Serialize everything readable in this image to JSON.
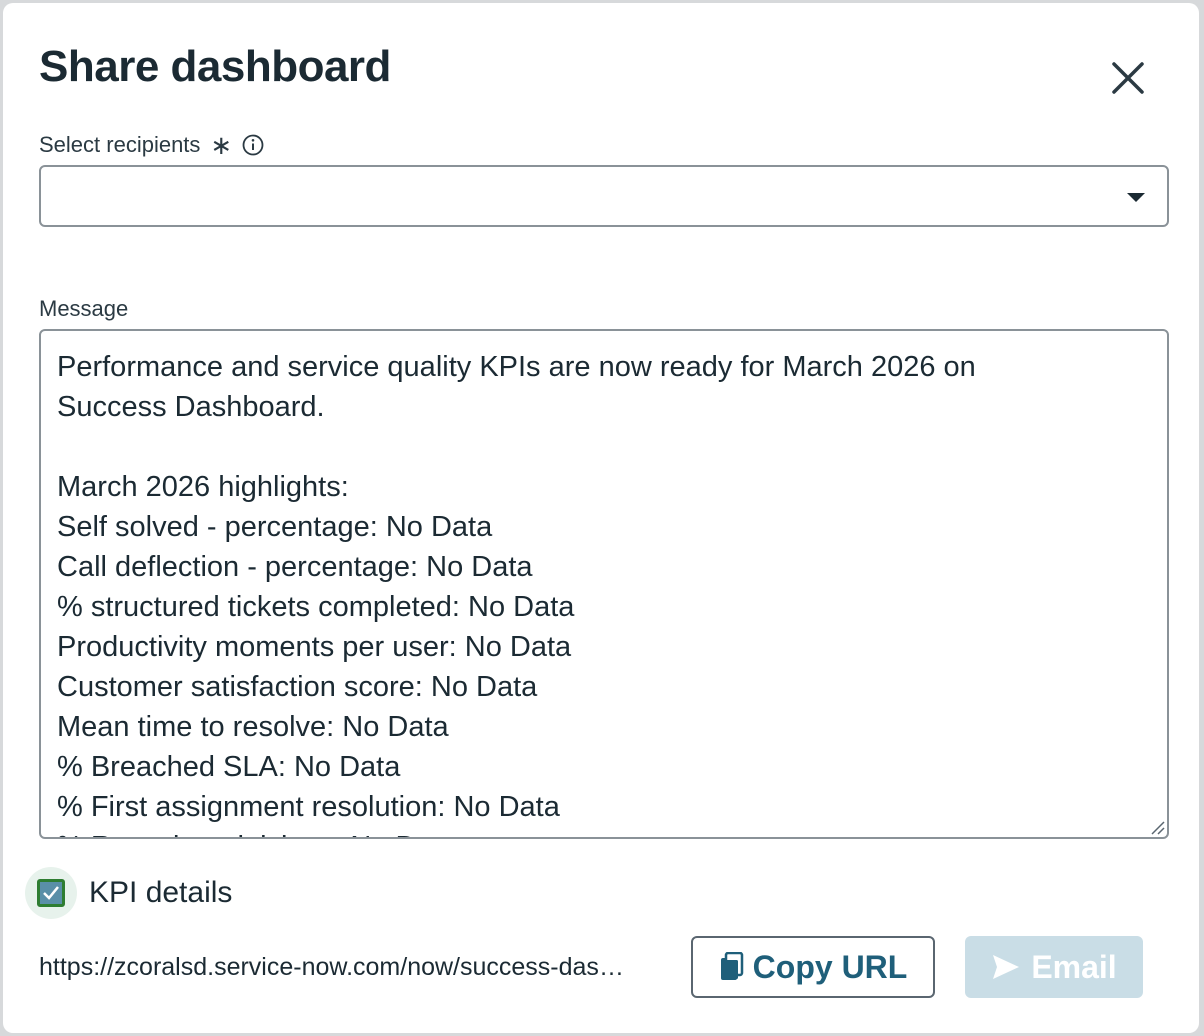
{
  "dialog": {
    "title": "Share dashboard"
  },
  "recipients": {
    "label": "Select recipients",
    "required_mark": "∗",
    "value": ""
  },
  "message": {
    "label": "Message",
    "text": "Performance and service quality KPIs are now ready for March 2026 on\nSuccess Dashboard.\n\nMarch 2026 highlights:\nSelf solved - percentage: No Data\nCall deflection - percentage: No Data\n% structured tickets completed: No Data\nProductivity moments per user: No Data\nCustomer satisfaction score: No Data\nMean time to resolve: No Data\n% Breached SLA: No Data\n% First assignment resolution: No Data\n% Reassigned tickets: No Data"
  },
  "kpi_details": {
    "label": "KPI details",
    "checked": true
  },
  "footer": {
    "url": "https://zcoralsd.service-now.com/now/success-dashboard",
    "copy_label": "Copy URL",
    "email_label": "Email"
  },
  "icons": {
    "close": "close-icon",
    "info": "info-icon",
    "caret": "chevron-down-icon",
    "copy": "copy-icon",
    "send": "send-icon",
    "check": "check-icon"
  },
  "colors": {
    "copy_text": "#1f5f7a",
    "email_disabled_bg": "#c9dde6",
    "checkbox_border": "#2e7d32"
  }
}
